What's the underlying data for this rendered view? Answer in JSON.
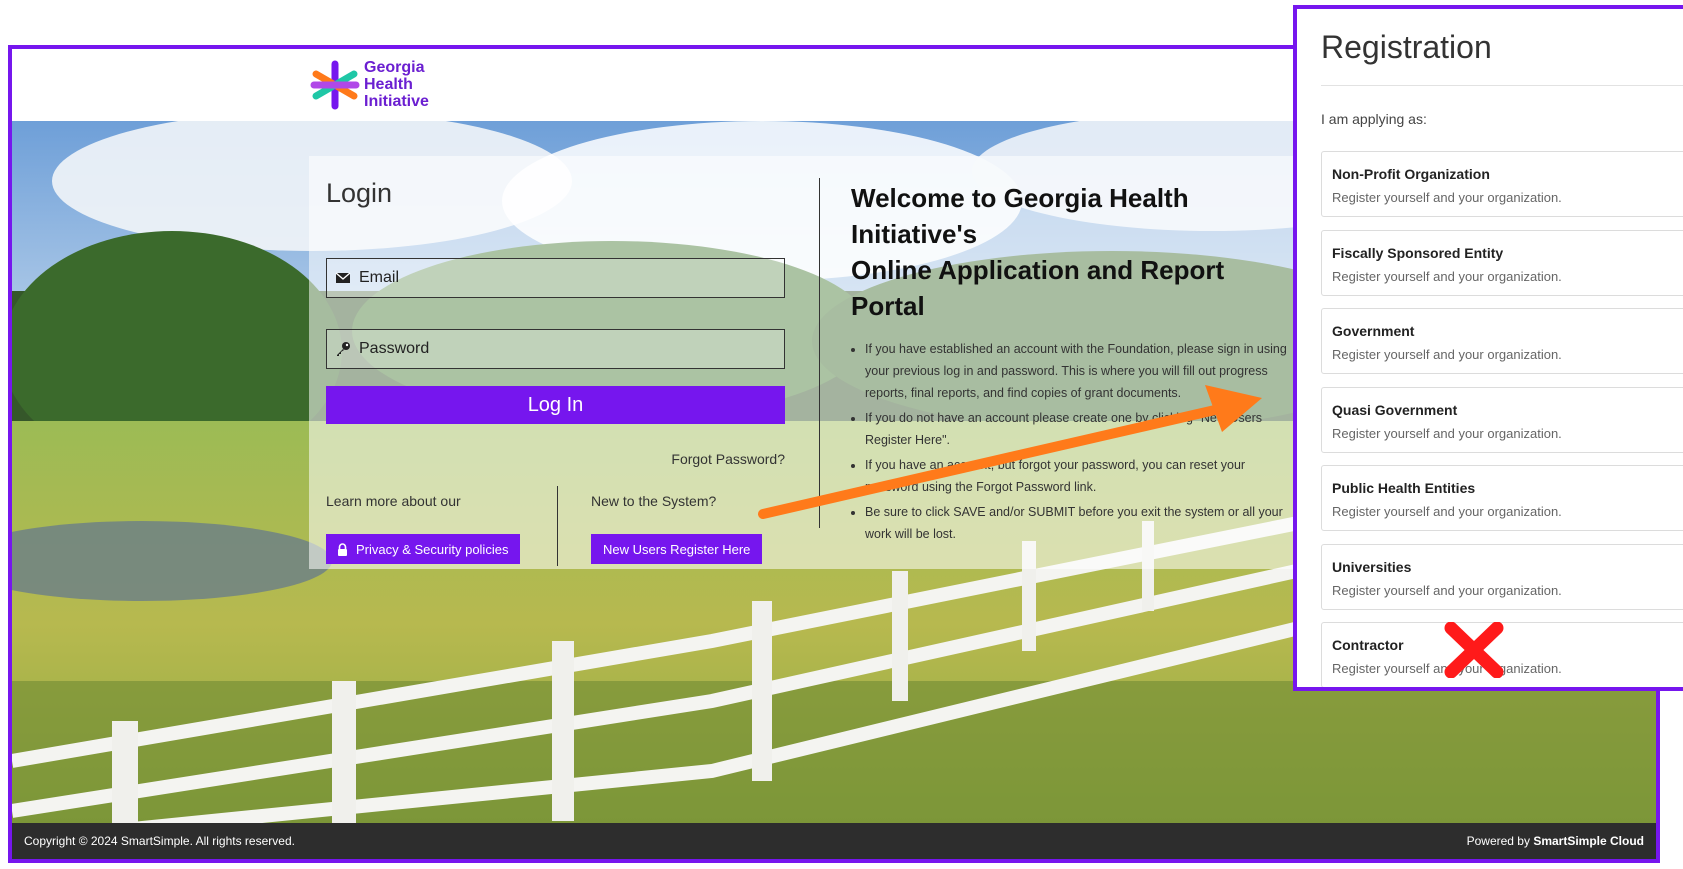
{
  "logo": {
    "line1": "Georgia",
    "line2": "Health",
    "line3": "Initiative"
  },
  "login": {
    "title": "Login",
    "email_placeholder": "Email",
    "password_placeholder": "Password",
    "login_button": "Log In",
    "forgot_password": "Forgot Password?",
    "learn_more": "Learn more about our",
    "privacy_button": "Privacy & Security policies",
    "new_to_system": "New to the System?",
    "register_button": "New Users Register Here"
  },
  "welcome": {
    "title_line1": "Welcome to Georgia Health Initiative's",
    "title_line2": "Online Application and Report Portal",
    "bullets": [
      "If you have established an account with the Foundation, please sign in using your previous log in and password. This is where you will fill out progress reports, final reports, and find copies of grant documents.",
      "If you do not have an account please create one by clicking \"New Users Register Here\".",
      "If you have an account, but forgot your password, you can reset your password using the Forgot Password link.",
      "Be sure to click SAVE and/or SUBMIT before you exit the system or all your work will be lost."
    ]
  },
  "footer": {
    "copyright": "Copyright © 2024 SmartSimple. All rights reserved.",
    "powered_by": "Powered by",
    "powered_brand": "SmartSimple Cloud"
  },
  "registration": {
    "title": "Registration",
    "subtitle": "I am applying as:",
    "options": [
      {
        "name": "Non-Profit Organization",
        "desc": "Register yourself and your organization."
      },
      {
        "name": "Fiscally Sponsored Entity",
        "desc": "Register yourself and your organization."
      },
      {
        "name": "Government",
        "desc": "Register yourself and your organization."
      },
      {
        "name": "Quasi Government",
        "desc": "Register yourself and your organization."
      },
      {
        "name": "Public Health Entities",
        "desc": "Register yourself and your organization."
      },
      {
        "name": "Universities",
        "desc": "Register yourself and your organization."
      },
      {
        "name": "Contractor",
        "desc": "Register yourself and your organization."
      }
    ]
  },
  "colors": {
    "accent": "#7616ee",
    "arrow": "#ff7a1a",
    "x_mark": "#ff1a1a",
    "footer": "#2d2d2d"
  },
  "icons": [
    "envelope-icon",
    "key-icon",
    "lock-icon",
    "logo-star-icon",
    "red-x-icon",
    "orange-arrow"
  ]
}
